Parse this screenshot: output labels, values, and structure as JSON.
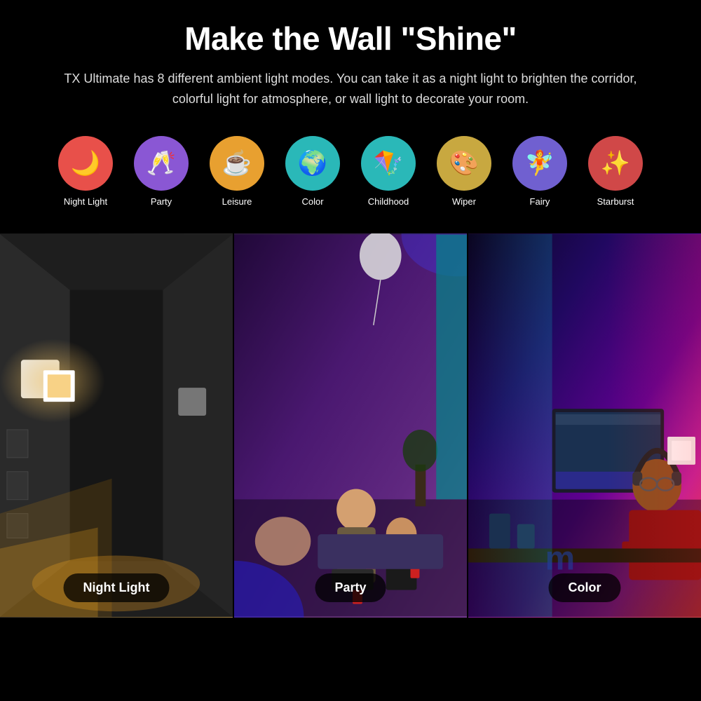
{
  "header": {
    "title": "Make the Wall \"Shine\"",
    "subtitle": "TX Ultimate has 8 different ambient light modes. You can take it as a night light to brighten the corridor, colorful light for atmosphere, or wall light to decorate your room."
  },
  "icons": [
    {
      "id": "night-light",
      "label": "Night Light",
      "emoji": "🌙",
      "colorClass": "ic-nightlight"
    },
    {
      "id": "party",
      "label": "Party",
      "emoji": "🥂",
      "colorClass": "ic-party"
    },
    {
      "id": "leisure",
      "label": "Leisure",
      "emoji": "☕",
      "colorClass": "ic-leisure"
    },
    {
      "id": "color",
      "label": "Color",
      "emoji": "🌍",
      "colorClass": "ic-color"
    },
    {
      "id": "childhood",
      "label": "Childhood",
      "emoji": "🪁",
      "colorClass": "ic-childhood"
    },
    {
      "id": "wiper",
      "label": "Wiper",
      "emoji": "🎨",
      "colorClass": "ic-wiper"
    },
    {
      "id": "fairy",
      "label": "Fairy",
      "emoji": "🧚",
      "colorClass": "ic-fairy"
    },
    {
      "id": "starburst",
      "label": "Starburst",
      "emoji": "✨",
      "colorClass": "ic-starburst"
    }
  ],
  "panels": [
    {
      "id": "night-light-panel",
      "label": "Night Light"
    },
    {
      "id": "party-panel",
      "label": "Party"
    },
    {
      "id": "color-panel",
      "label": "Color"
    }
  ]
}
